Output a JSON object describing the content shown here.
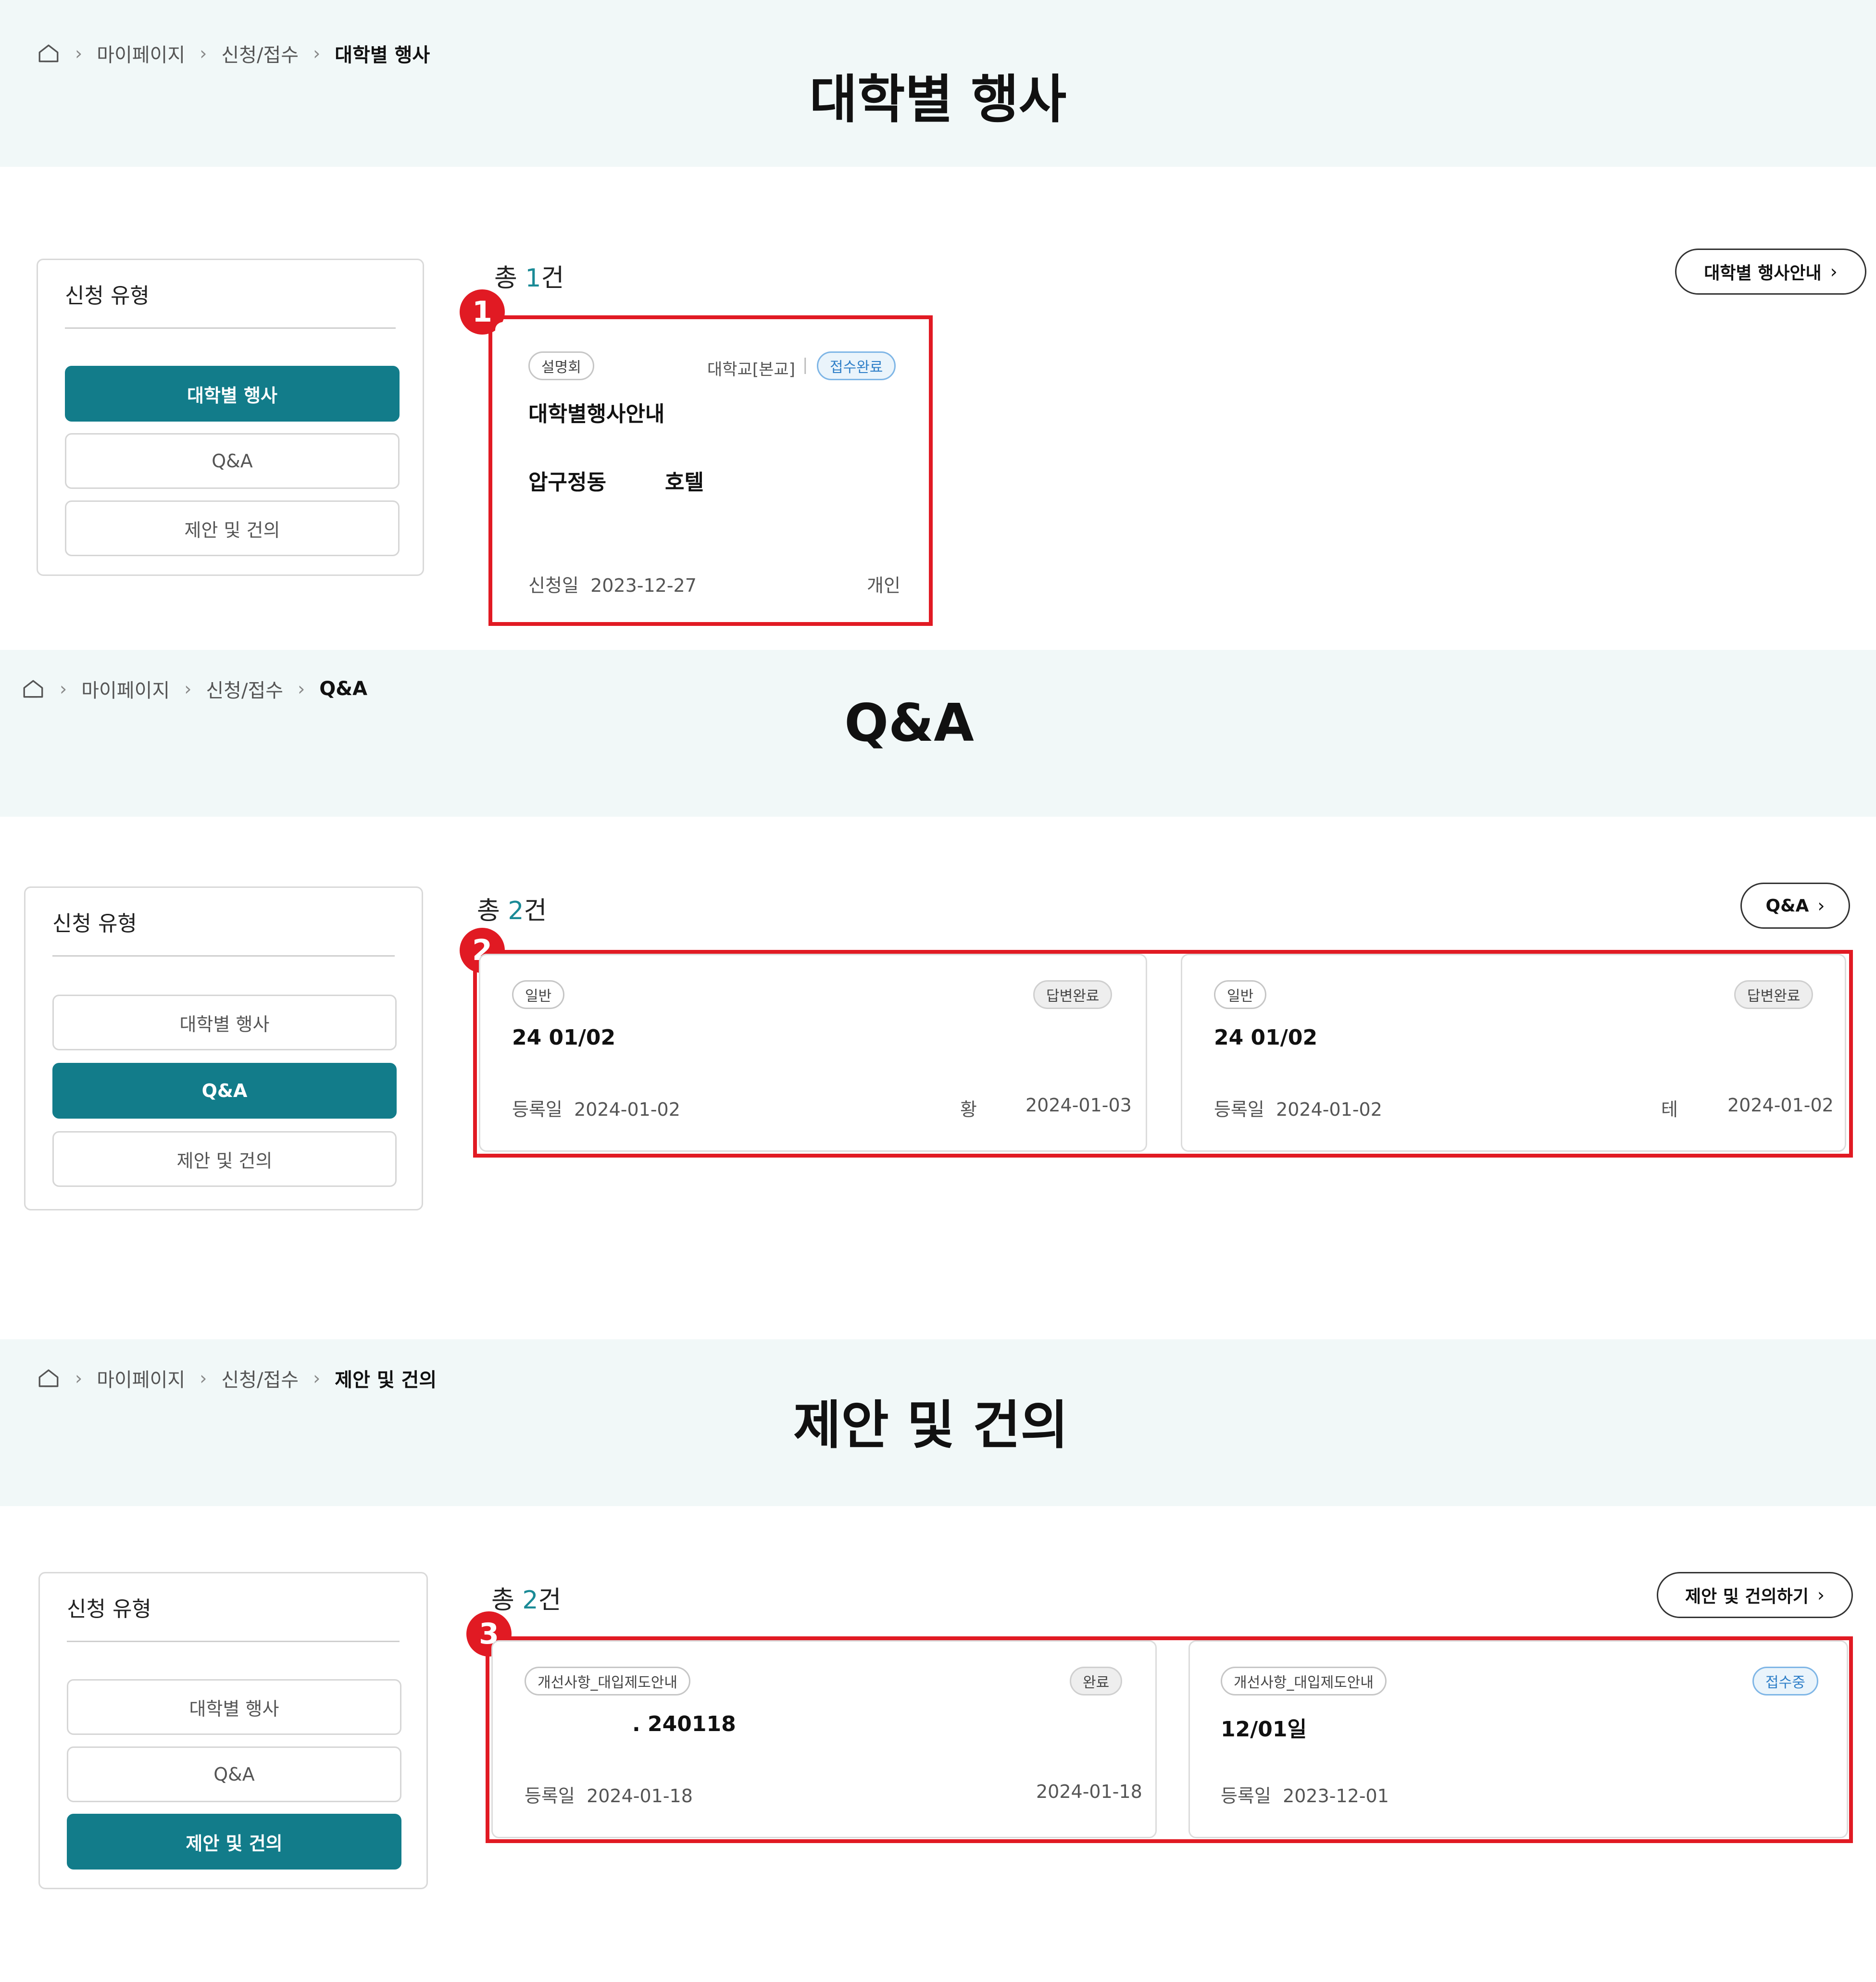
{
  "sections": [
    {
      "breadcrumb": {
        "items": [
          "마이페이지",
          "신청/접수"
        ],
        "current": "대학별 행사"
      },
      "title": "대학별 행사",
      "sidebar": {
        "heading": "신청 유형",
        "items": [
          "대학별 행사",
          "Q&A",
          "제안 및 건의"
        ],
        "active": 0
      },
      "total": {
        "prefix": "총 ",
        "count": "1",
        "suffix": "건"
      },
      "action_button": "대학별 행사안내",
      "marker": "1",
      "cards": [
        {
          "tag": "설명회",
          "org": "대학교[본교]",
          "status": "접수완료",
          "title": "대학별행사안내",
          "place1": "압구정동",
          "place2": "호텔",
          "date_label": "신청일",
          "date": "2023-12-27",
          "type": "개인"
        }
      ]
    },
    {
      "breadcrumb": {
        "items": [
          "마이페이지",
          "신청/접수"
        ],
        "current": "Q&A"
      },
      "title": "Q&A",
      "sidebar": {
        "heading": "신청 유형",
        "items": [
          "대학별 행사",
          "Q&A",
          "제안 및 건의"
        ],
        "active": 1
      },
      "total": {
        "prefix": "총 ",
        "count": "2",
        "suffix": "건"
      },
      "action_button": "Q&A",
      "marker": "2",
      "cards": [
        {
          "tag": "일반",
          "status": "답변완료",
          "title": "24 01/02",
          "date_label": "등록일",
          "date": "2024-01-02",
          "answerer": "황",
          "answer_date": "2024-01-03"
        },
        {
          "tag": "일반",
          "status": "답변완료",
          "title": "24 01/02",
          "date_label": "등록일",
          "date": "2024-01-02",
          "answerer": "테",
          "answer_date": "2024-01-02"
        }
      ]
    },
    {
      "breadcrumb": {
        "items": [
          "마이페이지",
          "신청/접수"
        ],
        "current": "제안 및 건의"
      },
      "title": "제안 및 건의",
      "sidebar": {
        "heading": "신청 유형",
        "items": [
          "대학별 행사",
          "Q&A",
          "제안 및 건의"
        ],
        "active": 2
      },
      "total": {
        "prefix": "총 ",
        "count": "2",
        "suffix": "건"
      },
      "action_button": "제안 및 건의하기",
      "marker": "3",
      "cards": [
        {
          "tag": "개선사항_대입제도안내",
          "status": "완료",
          "title": ". 240118",
          "date_label": "등록일",
          "date": "2024-01-18",
          "answer_date": "2024-01-18"
        },
        {
          "tag": "개선사항_대입제도안내",
          "status": "접수중",
          "title": "12/01일",
          "date_label": "등록일",
          "date": "2023-12-01"
        }
      ]
    }
  ],
  "icons": {
    "home": "home-icon",
    "separator": "chevron-right-icon"
  },
  "colors": {
    "accent": "#127c8a",
    "count": "#1a8a96",
    "highlight": "#e11a23",
    "hero_bg": "#f1f8f8"
  }
}
